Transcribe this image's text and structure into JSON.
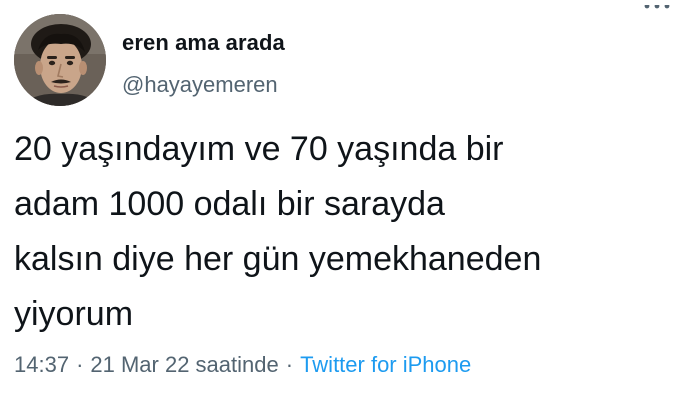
{
  "author": {
    "display_name": "eren ama arada",
    "handle": "@hayayemeren",
    "avatar_icon": "user-avatar-photo"
  },
  "tweet": {
    "lines": [
      "20 yaşındayım ve 70 yaşında bir",
      "adam 1000 odalı bir sarayda",
      "kalsın diye her gün yemekhaneden",
      "yiyorum"
    ]
  },
  "meta": {
    "time": "14:37",
    "separator": "·",
    "date": "21 Mar 22 saatinde",
    "source": "Twitter for iPhone"
  },
  "colors": {
    "text": "#0f1419",
    "secondary": "#536471",
    "link": "#1d9bf0"
  }
}
